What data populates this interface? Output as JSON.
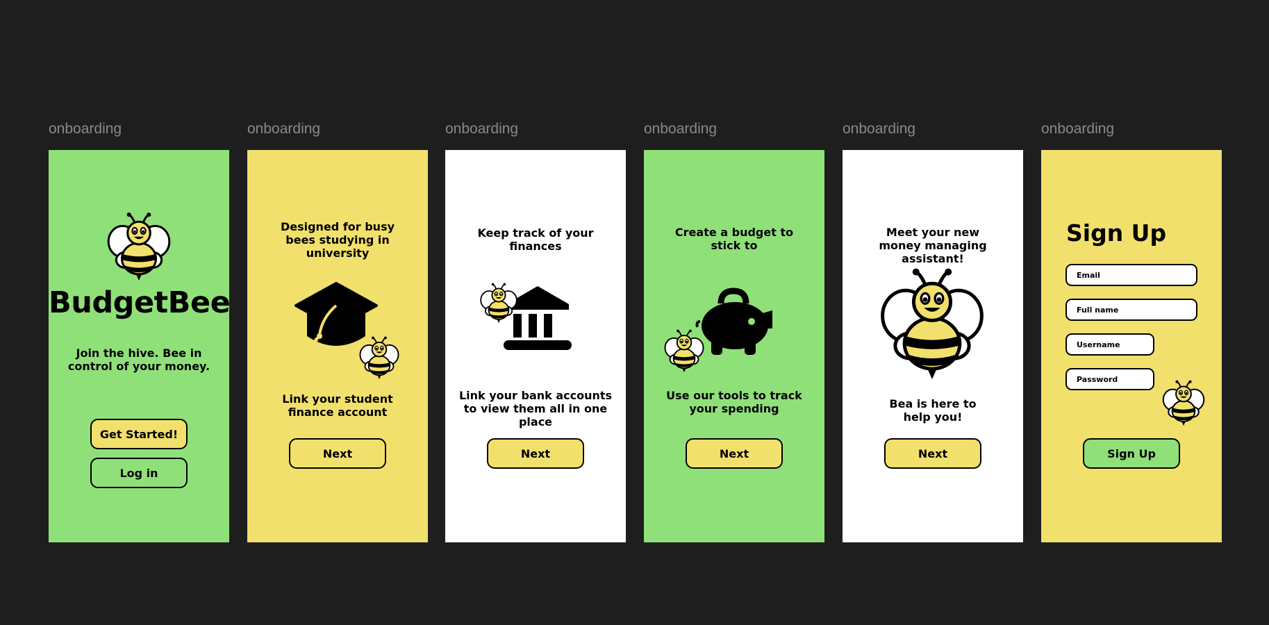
{
  "frame_label": "onboarding",
  "screens": [
    {
      "brand": "BudgetBee",
      "tagline": "Join the hive. Bee in control of your money.",
      "primary_button": "Get Started!",
      "secondary_button": "Log in",
      "icons": [
        "bee-icon"
      ]
    },
    {
      "heading": "Designed for busy bees studying in university",
      "body": "Link your student finance account",
      "button": "Next",
      "icons": [
        "graduation-cap-icon",
        "bee-icon"
      ]
    },
    {
      "heading": "Keep track of your finances",
      "body": "Link your bank accounts to view them all in one place",
      "button": "Next",
      "icons": [
        "bank-icon",
        "bee-icon"
      ]
    },
    {
      "heading": "Create a budget to stick to",
      "body": "Use our tools to track your spending",
      "button": "Next",
      "icons": [
        "piggy-bank-icon",
        "bee-icon"
      ]
    },
    {
      "heading": "Meet your new money managing assistant!",
      "body": "Bea is here to help you!",
      "button": "Next",
      "icons": [
        "bee-icon"
      ]
    },
    {
      "title": "Sign Up",
      "fields": {
        "email": "Email",
        "full_name": "Full name",
        "username": "Username",
        "password": "Password"
      },
      "button": "Sign Up",
      "icons": [
        "bee-icon"
      ]
    }
  ],
  "colors": {
    "background": "#1e1e1e",
    "green": "#90e07a",
    "yellow": "#f2e06d",
    "white": "#ffffff",
    "label": "#8a8a8a"
  }
}
